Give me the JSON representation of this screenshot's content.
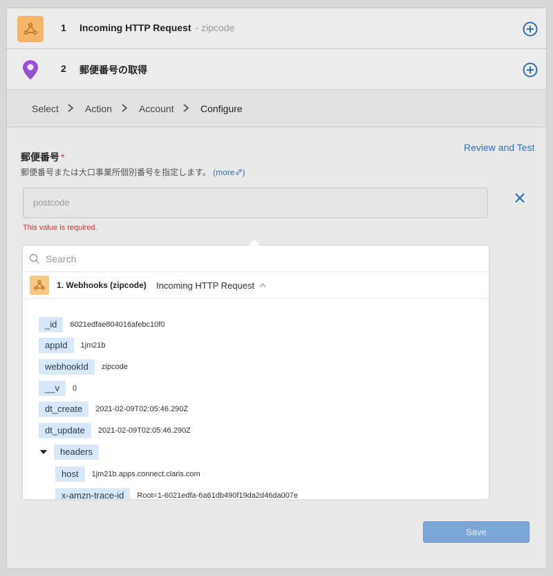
{
  "steps": [
    {
      "number": "1",
      "title": "Incoming HTTP Request",
      "subtitle": "- zipcode",
      "icon": "webhook-icon"
    },
    {
      "number": "2",
      "title": "郵便番号の取得",
      "subtitle": "",
      "icon": "map-pin-icon"
    }
  ],
  "breadcrumb": {
    "items": [
      "Select",
      "Action",
      "Account",
      "Configure"
    ],
    "active": "Configure"
  },
  "review_link": "Review and Test",
  "field": {
    "label": "郵便番号",
    "required_mark": "*",
    "description": "郵便番号または大口事業所個別番号を指定します。",
    "more_label": "(more",
    "more_close": ")",
    "placeholder": "postcode",
    "value": "",
    "error": "This value is required."
  },
  "dropdown": {
    "search_placeholder": "Search",
    "source": {
      "name": "1. Webhooks (zipcode)",
      "trigger": "Incoming HTTP Request"
    },
    "rows": [
      {
        "key": "_id",
        "value": "6021edfae804016afebc10f0"
      },
      {
        "key": "appId",
        "value": "1jm21b"
      },
      {
        "key": "webhookId",
        "value": "zipcode"
      },
      {
        "key": "__v",
        "value": "0"
      },
      {
        "key": "dt_create",
        "value": "2021-02-09T02:05:46.290Z"
      },
      {
        "key": "dt_update",
        "value": "2021-02-09T02:05:46.290Z"
      },
      {
        "key": "headers",
        "value": ""
      },
      {
        "key": "host",
        "value": "1jm21b.apps.connect.claris.com"
      },
      {
        "key": "x-amzn-trace-id",
        "value": "Root=1-6021edfa-6a61db490f19da2d46da007e"
      }
    ]
  },
  "save_label": "Save",
  "colors": {
    "accent": "#2f6db5",
    "tag_bg": "#d8e8f8",
    "error": "#d3302f",
    "webhook_orange": "#f2b56a",
    "pin_purple": "#9b4fd1"
  }
}
